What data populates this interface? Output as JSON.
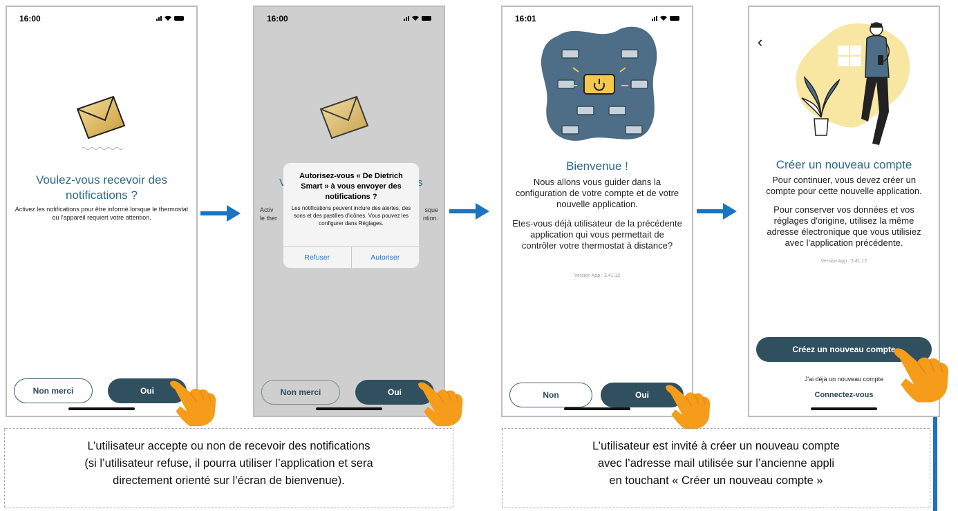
{
  "colors": {
    "accent": "#2b6a86",
    "button_dark": "#31505f",
    "arrow": "#1a74c0",
    "hand": "#f59c1a",
    "ios_link": "#1a7ad4"
  },
  "screen1": {
    "time": "16:00",
    "title": "Voulez-vous recevoir des notifications ?",
    "body": "Activez les notifications pour être informé lorsque le thermostat ou l'appareil requiert votre attention.",
    "btn_no": "Non merci",
    "btn_yes": "Oui"
  },
  "screen2": {
    "time": "16:00",
    "bg_left": "Activ",
    "bg_left2": "le ther",
    "bg_right": "sque",
    "bg_right2": "ntion.",
    "bg_title_left": "V",
    "bg_title_right": "s",
    "dialog_title": "Autorisez-vous « De Dietrich Smart » à vous envoyer des notifications ?",
    "dialog_text": "Les notifications peuvent inclure des alertes, des sons et des pastilles d'icônes. Vous pouvez les configurer dans Réglages.",
    "dialog_refuse": "Refuser",
    "dialog_allow": "Autoriser",
    "btn_no": "Non merci",
    "btn_yes": "Oui"
  },
  "screen3": {
    "time": "16:01",
    "title": "Bienvenue !",
    "body1": "Nous allons vous guider dans la configuration de votre compte et de votre nouvelle application.",
    "body2": "Etes-vous déjà utilisateur de la précédente application qui vous permettait de contrôler votre thermostat à distance?",
    "version": "Version App : 3.41.12",
    "btn_no": "Non",
    "btn_yes": "Oui"
  },
  "screen4": {
    "back": "‹",
    "title": "Créer un nouveau compte",
    "body1": "Pour continuer, vous devez créer un compte pour cette nouvelle application.",
    "body2": "Pour conserver vos données et vos réglages d'origine, utilisez la même adresse électronique que vous utilisiez avec l'application précédente.",
    "version": "Version App : 3.41.12",
    "btn_create": "Créez un nouveau compte",
    "already": "J'ai déjà un nouveau compte",
    "login": "Connectez-vous"
  },
  "caption_left": {
    "line1": "L’utilisateur accepte ou non de recevoir des notifications",
    "line2": "(si l’utilisateur refuse, il pourra utiliser l’application et sera",
    "line3": "directement orienté sur l’écran de bienvenue)."
  },
  "caption_right": {
    "line1": "L’utilisateur est invité à créer un nouveau compte",
    "line2": "avec l’adresse mail utilisée sur l’ancienne appli",
    "line3": "en touchant « Créer un nouveau compte »"
  }
}
